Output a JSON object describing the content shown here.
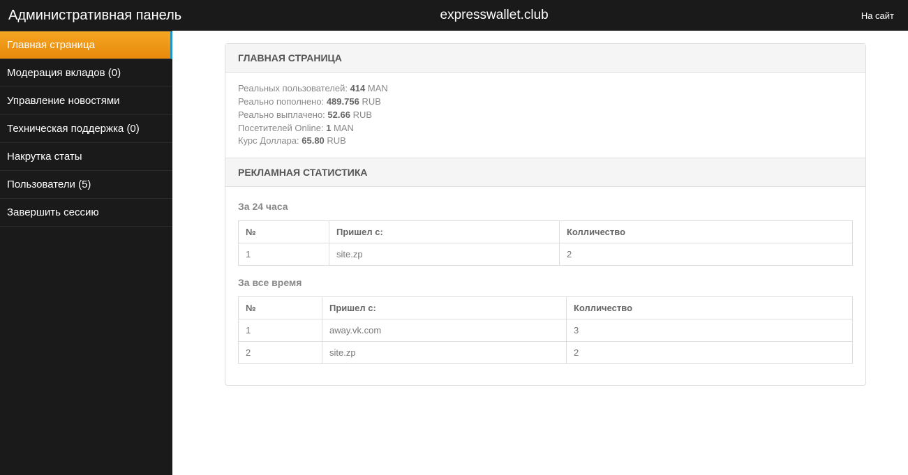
{
  "header": {
    "title": "Административная панель",
    "domain": "expresswallet.club",
    "site_link": "На сайт"
  },
  "sidebar": {
    "items": [
      {
        "label": "Главная страница",
        "active": true
      },
      {
        "label": "Модерация вкладов (0)",
        "active": false
      },
      {
        "label": "Управление новостями",
        "active": false
      },
      {
        "label": "Техническая поддержка (0)",
        "active": false
      },
      {
        "label": "Накрутка статы",
        "active": false
      },
      {
        "label": "Пользователи (5)",
        "active": false
      },
      {
        "label": "Завершить сессию",
        "active": false
      }
    ]
  },
  "main": {
    "heading": "ГЛАВНАЯ СТРАНИЦА",
    "stats": {
      "real_users_label": "Реальных пользователей: ",
      "real_users_value": "414",
      "real_users_unit": " MAN",
      "topup_label": "Реально пополнено: ",
      "topup_value": "489.756",
      "topup_unit": " RUB",
      "paid_label": "Реально выплачено: ",
      "paid_value": "52.66",
      "paid_unit": " RUB",
      "online_label": "Посетителей Online: ",
      "online_value": "1",
      "online_unit": " MAN",
      "rate_label": "Курс Доллара: ",
      "rate_value": "65.80",
      "rate_unit": " RUB"
    },
    "ad_heading": "РЕКЛАМНАЯ СТАТИСТИКА",
    "t24": {
      "title": "За 24 часа",
      "cols": {
        "num": "№",
        "from": "Пришел с:",
        "count": "Колличество"
      },
      "rows": [
        {
          "num": "1",
          "from": "site.zp",
          "count": "2"
        }
      ]
    },
    "tall": {
      "title": "За все время",
      "cols": {
        "num": "№",
        "from": "Пришел с:",
        "count": "Колличество"
      },
      "rows": [
        {
          "num": "1",
          "from": "away.vk.com",
          "count": "3"
        },
        {
          "num": "2",
          "from": "site.zp",
          "count": "2"
        }
      ]
    }
  }
}
